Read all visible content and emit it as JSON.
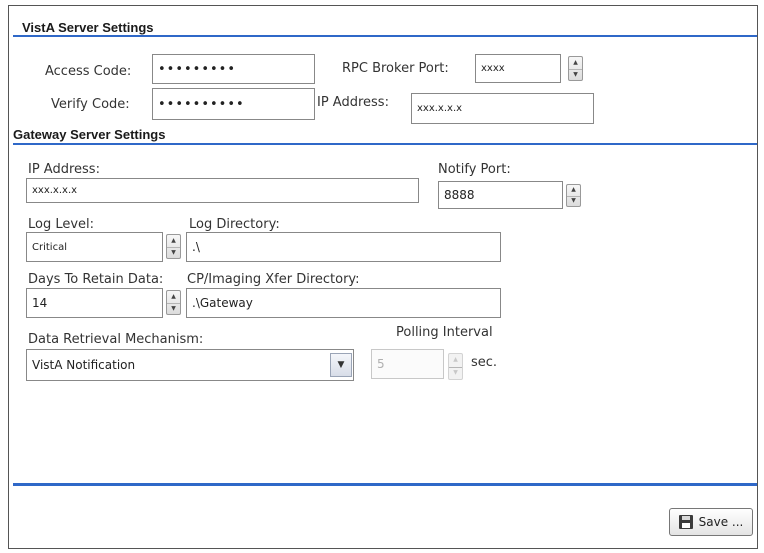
{
  "vista": {
    "title": "VistA Server Settings",
    "access_code_label": "Access Code:",
    "access_code_value": "•••••••••",
    "verify_code_label": "Verify Code:",
    "verify_code_value": "••••••••••",
    "rpc_port_label": "RPC Broker Port:",
    "rpc_port_value": "xxxx",
    "ip_label": "IP Address:",
    "ip_value": "xxx.x.x.x"
  },
  "gateway": {
    "title": "Gateway Server Settings",
    "ip_label": "IP Address:",
    "ip_value": "xxx.x.x.x",
    "notify_port_label": "Notify Port:",
    "notify_port_value": "8888",
    "log_level_label": "Log Level:",
    "log_level_value": "Critical",
    "log_dir_label": "Log Directory:",
    "log_dir_value": ".\\",
    "days_label": "Days To Retain Data:",
    "days_value": "14",
    "xfer_dir_label": "CP/Imaging Xfer Directory:",
    "xfer_dir_value": ".\\Gateway",
    "mechanism_label": "Data Retrieval Mechanism:",
    "mechanism_value": "VistA Notification",
    "polling_label": "Polling Interval",
    "polling_value": "5",
    "polling_unit": "sec."
  },
  "footer": {
    "save_label": "Save ..."
  },
  "icons": {
    "spinner_up": "▲",
    "spinner_down": "▼",
    "dropdown": "chevron-down-icon",
    "save": "floppy-disk-icon"
  },
  "colors": {
    "section_rule": "#2f68c8"
  }
}
